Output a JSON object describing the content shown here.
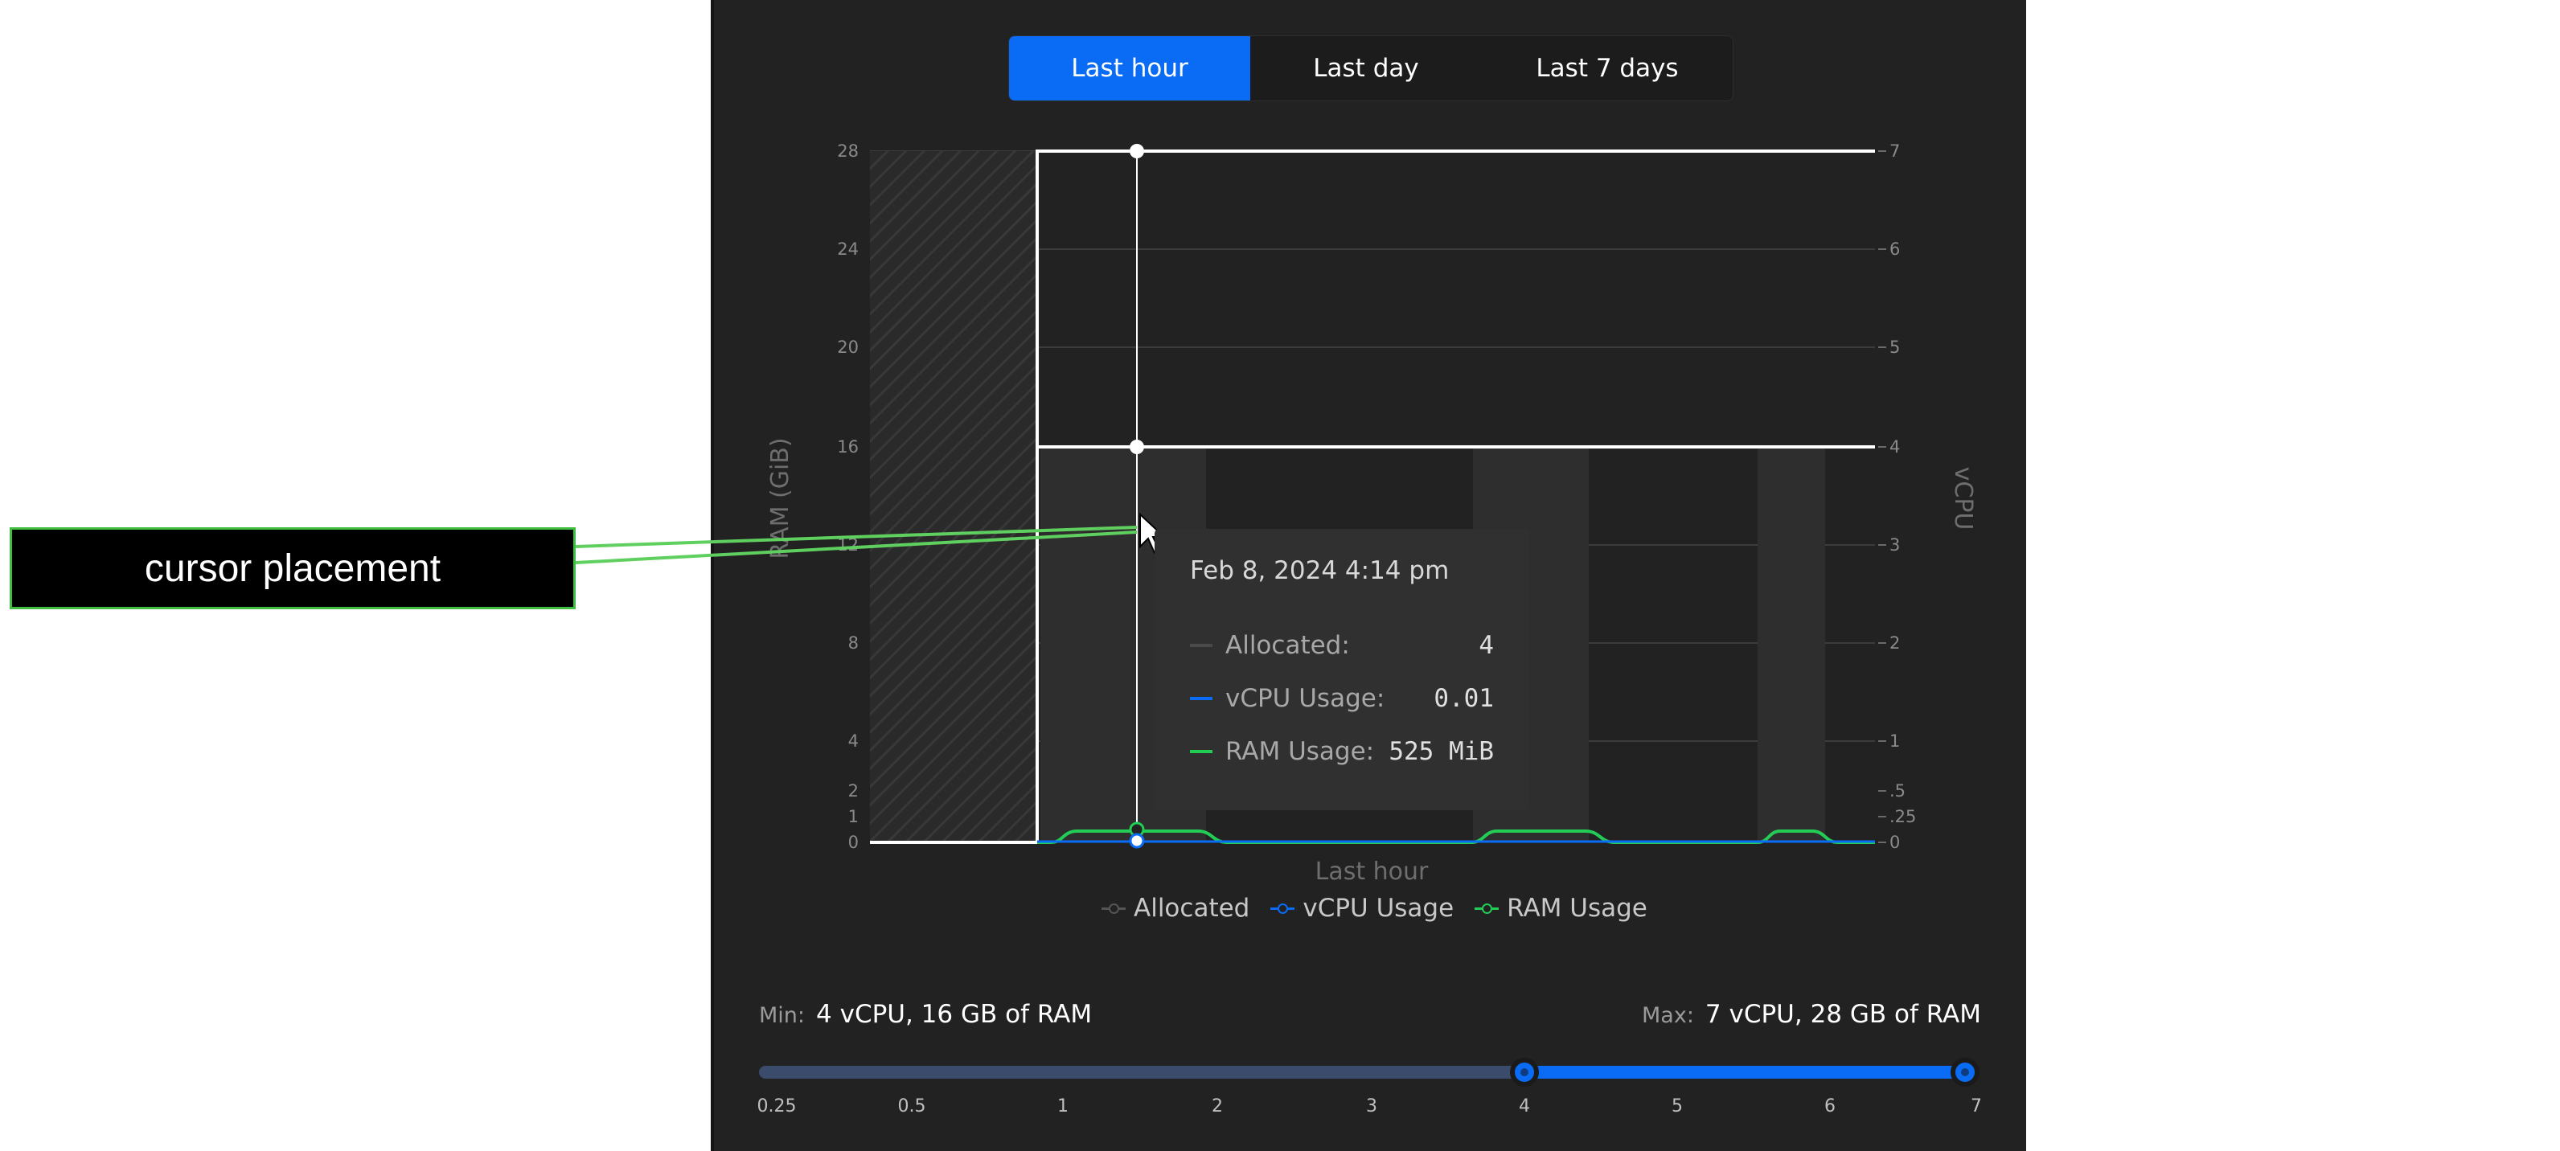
{
  "tabs": [
    {
      "label": "Last hour",
      "active": true
    },
    {
      "label": "Last day",
      "active": false
    },
    {
      "label": "Last 7 days",
      "active": false
    }
  ],
  "chart_data": {
    "type": "line",
    "xlabel": "Last hour",
    "y_left_label": "RAM (GiB)",
    "y_right_label": "vCPU",
    "y_left_ticks": [
      "28",
      "24",
      "20",
      "16",
      "12",
      "8",
      "4",
      "2",
      "1",
      "0"
    ],
    "y_right_ticks": [
      "7",
      "6",
      "5",
      "4",
      "3",
      "2",
      "1",
      ".5",
      ".25",
      "0"
    ],
    "y_left_range": [
      0,
      28
    ],
    "y_right_range": [
      0,
      7
    ],
    "series": [
      {
        "name": "Allocated",
        "note": "max 7 vCPU / min 4 vCPU allocation lines after start",
        "values": [
          0,
          7,
          7,
          7
        ]
      },
      {
        "name": "vCPU Usage",
        "values": [
          0,
          0.01,
          0.01,
          0
        ]
      },
      {
        "name": "RAM Usage",
        "values": [
          0,
          0.5,
          0.5,
          0
        ]
      }
    ],
    "legend_position": "bottom",
    "grid": true
  },
  "tooltip": {
    "date": "Feb 8, 2024 4:14 pm",
    "rows": [
      {
        "label": "Allocated:",
        "value": "4",
        "color": "#444444"
      },
      {
        "label": "vCPU Usage:",
        "value": "0.01",
        "color": "#0a6cf5"
      },
      {
        "label": "RAM Usage:",
        "value": "525 MiB",
        "color": "#22cc55"
      }
    ]
  },
  "legend": [
    {
      "label": "Allocated",
      "color": "#555555"
    },
    {
      "label": "vCPU Usage",
      "color": "#0a6cf5"
    },
    {
      "label": "RAM Usage",
      "color": "#22cc55"
    }
  ],
  "range": {
    "min_key": "Min:",
    "min_value": "4 vCPU, 16 GB of RAM",
    "max_key": "Max:",
    "max_value": "7 vCPU, 28 GB of RAM",
    "ticks": [
      "0.25",
      "0.5",
      "1",
      "2",
      "3",
      "4",
      "5",
      "6",
      "7"
    ],
    "selected_min": "4",
    "selected_max": "7"
  },
  "callout": {
    "label": "cursor placement"
  }
}
